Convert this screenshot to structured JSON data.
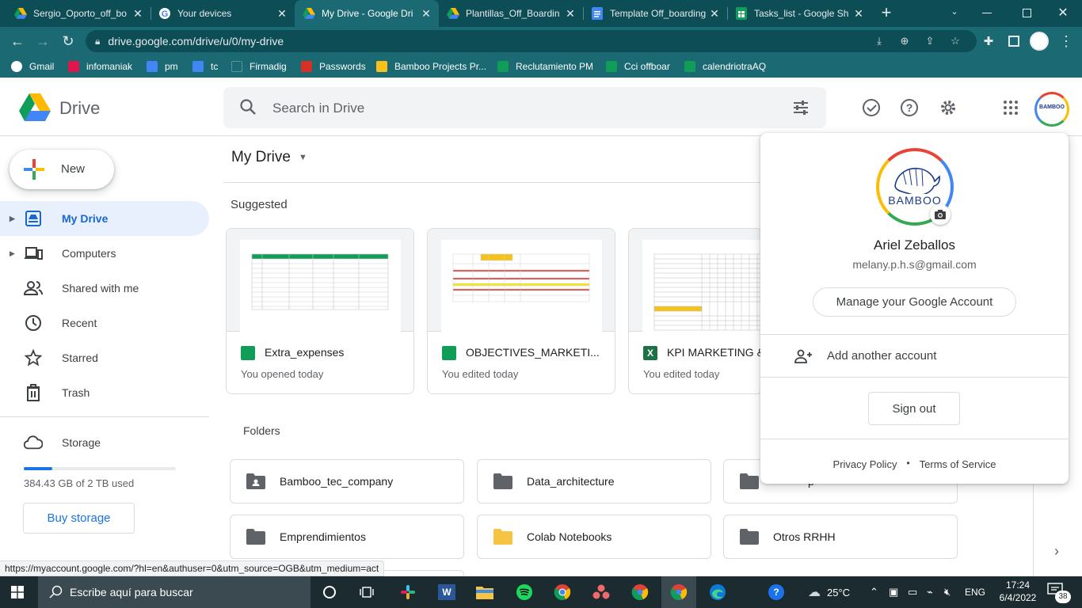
{
  "browser": {
    "tabs": [
      {
        "title": "Sergio_Oporto_off_bo",
        "icon": "drive-icon"
      },
      {
        "title": "Your devices",
        "icon": "google-icon"
      },
      {
        "title": "My Drive - Google Dri",
        "icon": "drive-icon",
        "active": true
      },
      {
        "title": "Plantillas_Off_Boardin",
        "icon": "drive-icon"
      },
      {
        "title": "Template Off_boarding",
        "icon": "docs-icon"
      },
      {
        "title": "Tasks_list - Google Sh",
        "icon": "sheets-icon"
      }
    ],
    "new_tab": "+",
    "url": "drive.google.com/drive/u/0/my-drive",
    "bookmarks": [
      {
        "label": "Gmail"
      },
      {
        "label": "infomaniak"
      },
      {
        "label": "pm"
      },
      {
        "label": "tc"
      },
      {
        "label": "Firmadig"
      },
      {
        "label": "Passwords"
      },
      {
        "label": "Bamboo Projects Pr..."
      },
      {
        "label": "Reclutamiento PM"
      },
      {
        "label": "Cci offboar"
      },
      {
        "label": "calendriotraAQ"
      }
    ]
  },
  "header": {
    "app_name": "Drive",
    "search_placeholder": "Search in Drive"
  },
  "sidebar": {
    "new_label": "New",
    "items": [
      {
        "label": "My Drive"
      },
      {
        "label": "Computers"
      },
      {
        "label": "Shared with me"
      },
      {
        "label": "Recent"
      },
      {
        "label": "Starred"
      },
      {
        "label": "Trash"
      }
    ],
    "storage_label": "Storage",
    "storage_used_text": "384.43 GB of 2 TB used",
    "storage_fraction": 0.19,
    "buy_storage": "Buy storage"
  },
  "main": {
    "title": "My Drive",
    "suggested_label": "Suggested",
    "suggested": [
      {
        "name": "Extra_expenses",
        "meta": "You opened today",
        "type": "sheets"
      },
      {
        "name": "OBJECTIVES_MARKETI...",
        "meta": "You edited today",
        "type": "sheets"
      },
      {
        "name": "KPI MARKETING &",
        "meta": "You edited today",
        "type": "excel"
      }
    ],
    "folders_label": "Folders",
    "folders": [
      {
        "name": "Bamboo_tec_company",
        "shared": true
      },
      {
        "name": "Data_architecture"
      },
      {
        "name": "p"
      },
      {
        "name": "Emprendimientos"
      },
      {
        "name": "Colab Notebooks",
        "yellow": true
      },
      {
        "name": "Otros RRHH"
      }
    ]
  },
  "account_popup": {
    "name": "Ariel Zeballos",
    "email": "melany.p.h.s@gmail.com",
    "avatar_text": "BAMBOO",
    "manage": "Manage your Google Account",
    "add_account": "Add another account",
    "sign_out": "Sign out",
    "privacy": "Privacy Policy",
    "dot": "•",
    "terms": "Terms of Service"
  },
  "status_url": "https://myaccount.google.com/?hl=en&authuser=0&utm_source=OGB&utm_medium=act",
  "taskbar": {
    "search_placeholder": "Escribe aquí para buscar",
    "weather": "25°C",
    "lang": "ENG",
    "time": "17:24",
    "date": "6/4/2022",
    "notifications": "38"
  },
  "colors": {
    "tab_bg": "#0c4d56",
    "toolbar_bg": "#1b6973",
    "drive_blue": "#1967d2",
    "active_nav_bg": "#e8f0fe"
  }
}
